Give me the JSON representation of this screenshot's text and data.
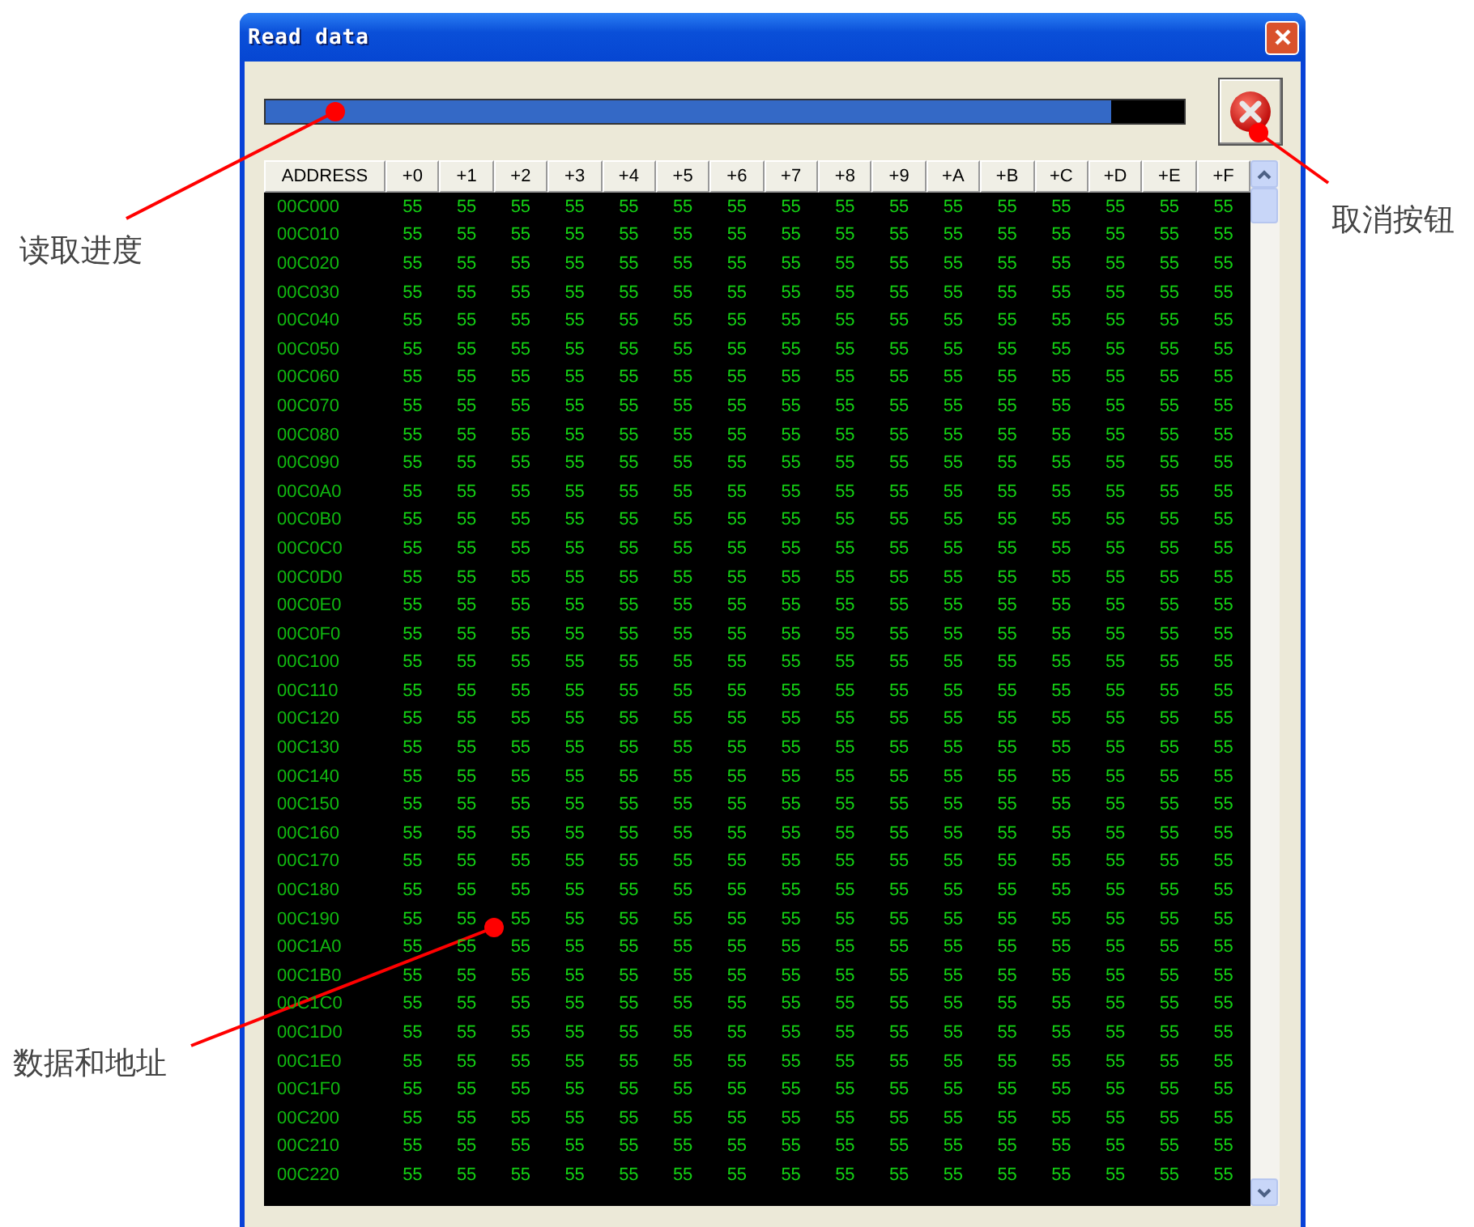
{
  "window": {
    "title": "Read data"
  },
  "progress": {
    "level": 0.92
  },
  "table": {
    "columns": [
      "ADDRESS",
      "+0",
      "+1",
      "+2",
      "+3",
      "+4",
      "+5",
      "+6",
      "+7",
      "+8",
      "+9",
      "+A",
      "+B",
      "+C",
      "+D",
      "+E",
      "+F"
    ],
    "rows": [
      {
        "address": "00C000",
        "bytes": [
          "55",
          "55",
          "55",
          "55",
          "55",
          "55",
          "55",
          "55",
          "55",
          "55",
          "55",
          "55",
          "55",
          "55",
          "55",
          "55"
        ]
      },
      {
        "address": "00C010",
        "bytes": [
          "55",
          "55",
          "55",
          "55",
          "55",
          "55",
          "55",
          "55",
          "55",
          "55",
          "55",
          "55",
          "55",
          "55",
          "55",
          "55"
        ]
      },
      {
        "address": "00C020",
        "bytes": [
          "55",
          "55",
          "55",
          "55",
          "55",
          "55",
          "55",
          "55",
          "55",
          "55",
          "55",
          "55",
          "55",
          "55",
          "55",
          "55"
        ]
      },
      {
        "address": "00C030",
        "bytes": [
          "55",
          "55",
          "55",
          "55",
          "55",
          "55",
          "55",
          "55",
          "55",
          "55",
          "55",
          "55",
          "55",
          "55",
          "55",
          "55"
        ]
      },
      {
        "address": "00C040",
        "bytes": [
          "55",
          "55",
          "55",
          "55",
          "55",
          "55",
          "55",
          "55",
          "55",
          "55",
          "55",
          "55",
          "55",
          "55",
          "55",
          "55"
        ]
      },
      {
        "address": "00C050",
        "bytes": [
          "55",
          "55",
          "55",
          "55",
          "55",
          "55",
          "55",
          "55",
          "55",
          "55",
          "55",
          "55",
          "55",
          "55",
          "55",
          "55"
        ]
      },
      {
        "address": "00C060",
        "bytes": [
          "55",
          "55",
          "55",
          "55",
          "55",
          "55",
          "55",
          "55",
          "55",
          "55",
          "55",
          "55",
          "55",
          "55",
          "55",
          "55"
        ]
      },
      {
        "address": "00C070",
        "bytes": [
          "55",
          "55",
          "55",
          "55",
          "55",
          "55",
          "55",
          "55",
          "55",
          "55",
          "55",
          "55",
          "55",
          "55",
          "55",
          "55"
        ]
      },
      {
        "address": "00C080",
        "bytes": [
          "55",
          "55",
          "55",
          "55",
          "55",
          "55",
          "55",
          "55",
          "55",
          "55",
          "55",
          "55",
          "55",
          "55",
          "55",
          "55"
        ]
      },
      {
        "address": "00C090",
        "bytes": [
          "55",
          "55",
          "55",
          "55",
          "55",
          "55",
          "55",
          "55",
          "55",
          "55",
          "55",
          "55",
          "55",
          "55",
          "55",
          "55"
        ]
      },
      {
        "address": "00C0A0",
        "bytes": [
          "55",
          "55",
          "55",
          "55",
          "55",
          "55",
          "55",
          "55",
          "55",
          "55",
          "55",
          "55",
          "55",
          "55",
          "55",
          "55"
        ]
      },
      {
        "address": "00C0B0",
        "bytes": [
          "55",
          "55",
          "55",
          "55",
          "55",
          "55",
          "55",
          "55",
          "55",
          "55",
          "55",
          "55",
          "55",
          "55",
          "55",
          "55"
        ]
      },
      {
        "address": "00C0C0",
        "bytes": [
          "55",
          "55",
          "55",
          "55",
          "55",
          "55",
          "55",
          "55",
          "55",
          "55",
          "55",
          "55",
          "55",
          "55",
          "55",
          "55"
        ]
      },
      {
        "address": "00C0D0",
        "bytes": [
          "55",
          "55",
          "55",
          "55",
          "55",
          "55",
          "55",
          "55",
          "55",
          "55",
          "55",
          "55",
          "55",
          "55",
          "55",
          "55"
        ]
      },
      {
        "address": "00C0E0",
        "bytes": [
          "55",
          "55",
          "55",
          "55",
          "55",
          "55",
          "55",
          "55",
          "55",
          "55",
          "55",
          "55",
          "55",
          "55",
          "55",
          "55"
        ]
      },
      {
        "address": "00C0F0",
        "bytes": [
          "55",
          "55",
          "55",
          "55",
          "55",
          "55",
          "55",
          "55",
          "55",
          "55",
          "55",
          "55",
          "55",
          "55",
          "55",
          "55"
        ]
      },
      {
        "address": "00C100",
        "bytes": [
          "55",
          "55",
          "55",
          "55",
          "55",
          "55",
          "55",
          "55",
          "55",
          "55",
          "55",
          "55",
          "55",
          "55",
          "55",
          "55"
        ]
      },
      {
        "address": "00C110",
        "bytes": [
          "55",
          "55",
          "55",
          "55",
          "55",
          "55",
          "55",
          "55",
          "55",
          "55",
          "55",
          "55",
          "55",
          "55",
          "55",
          "55"
        ]
      },
      {
        "address": "00C120",
        "bytes": [
          "55",
          "55",
          "55",
          "55",
          "55",
          "55",
          "55",
          "55",
          "55",
          "55",
          "55",
          "55",
          "55",
          "55",
          "55",
          "55"
        ]
      },
      {
        "address": "00C130",
        "bytes": [
          "55",
          "55",
          "55",
          "55",
          "55",
          "55",
          "55",
          "55",
          "55",
          "55",
          "55",
          "55",
          "55",
          "55",
          "55",
          "55"
        ]
      },
      {
        "address": "00C140",
        "bytes": [
          "55",
          "55",
          "55",
          "55",
          "55",
          "55",
          "55",
          "55",
          "55",
          "55",
          "55",
          "55",
          "55",
          "55",
          "55",
          "55"
        ]
      },
      {
        "address": "00C150",
        "bytes": [
          "55",
          "55",
          "55",
          "55",
          "55",
          "55",
          "55",
          "55",
          "55",
          "55",
          "55",
          "55",
          "55",
          "55",
          "55",
          "55"
        ]
      },
      {
        "address": "00C160",
        "bytes": [
          "55",
          "55",
          "55",
          "55",
          "55",
          "55",
          "55",
          "55",
          "55",
          "55",
          "55",
          "55",
          "55",
          "55",
          "55",
          "55"
        ]
      },
      {
        "address": "00C170",
        "bytes": [
          "55",
          "55",
          "55",
          "55",
          "55",
          "55",
          "55",
          "55",
          "55",
          "55",
          "55",
          "55",
          "55",
          "55",
          "55",
          "55"
        ]
      },
      {
        "address": "00C180",
        "bytes": [
          "55",
          "55",
          "55",
          "55",
          "55",
          "55",
          "55",
          "55",
          "55",
          "55",
          "55",
          "55",
          "55",
          "55",
          "55",
          "55"
        ]
      },
      {
        "address": "00C190",
        "bytes": [
          "55",
          "55",
          "55",
          "55",
          "55",
          "55",
          "55",
          "55",
          "55",
          "55",
          "55",
          "55",
          "55",
          "55",
          "55",
          "55"
        ]
      },
      {
        "address": "00C1A0",
        "bytes": [
          "55",
          "55",
          "55",
          "55",
          "55",
          "55",
          "55",
          "55",
          "55",
          "55",
          "55",
          "55",
          "55",
          "55",
          "55",
          "55"
        ]
      },
      {
        "address": "00C1B0",
        "bytes": [
          "55",
          "55",
          "55",
          "55",
          "55",
          "55",
          "55",
          "55",
          "55",
          "55",
          "55",
          "55",
          "55",
          "55",
          "55",
          "55"
        ]
      },
      {
        "address": "00C1C0",
        "bytes": [
          "55",
          "55",
          "55",
          "55",
          "55",
          "55",
          "55",
          "55",
          "55",
          "55",
          "55",
          "55",
          "55",
          "55",
          "55",
          "55"
        ]
      },
      {
        "address": "00C1D0",
        "bytes": [
          "55",
          "55",
          "55",
          "55",
          "55",
          "55",
          "55",
          "55",
          "55",
          "55",
          "55",
          "55",
          "55",
          "55",
          "55",
          "55"
        ]
      },
      {
        "address": "00C1E0",
        "bytes": [
          "55",
          "55",
          "55",
          "55",
          "55",
          "55",
          "55",
          "55",
          "55",
          "55",
          "55",
          "55",
          "55",
          "55",
          "55",
          "55"
        ]
      },
      {
        "address": "00C1F0",
        "bytes": [
          "55",
          "55",
          "55",
          "55",
          "55",
          "55",
          "55",
          "55",
          "55",
          "55",
          "55",
          "55",
          "55",
          "55",
          "55",
          "55"
        ]
      },
      {
        "address": "00C200",
        "bytes": [
          "55",
          "55",
          "55",
          "55",
          "55",
          "55",
          "55",
          "55",
          "55",
          "55",
          "55",
          "55",
          "55",
          "55",
          "55",
          "55"
        ]
      },
      {
        "address": "00C210",
        "bytes": [
          "55",
          "55",
          "55",
          "55",
          "55",
          "55",
          "55",
          "55",
          "55",
          "55",
          "55",
          "55",
          "55",
          "55",
          "55",
          "55"
        ]
      },
      {
        "address": "00C220",
        "bytes": [
          "55",
          "55",
          "55",
          "55",
          "55",
          "55",
          "55",
          "55",
          "55",
          "55",
          "55",
          "55",
          "55",
          "55",
          "55",
          "55"
        ]
      }
    ]
  },
  "annotations": [
    {
      "text": "读取进度"
    },
    {
      "text": "取消按钮"
    },
    {
      "text": "数据和地址"
    }
  ]
}
